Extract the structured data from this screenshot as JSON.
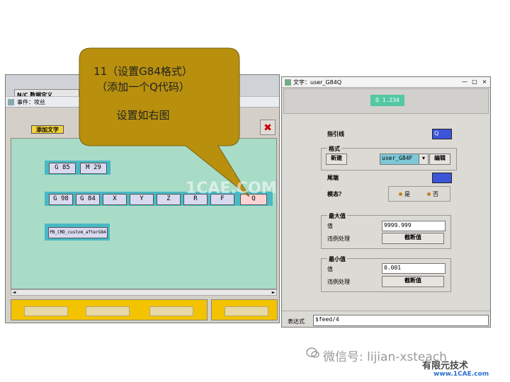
{
  "left_window": {
    "tabs": [
      "N/C 数据定义",
      ""
    ],
    "title": "事件：攻丝",
    "add_text_label": "添加文字",
    "delete_icon": "delete-icon",
    "row1": [
      "G 85",
      "M 29"
    ],
    "row2": [
      "G 98",
      "G 84",
      "X",
      "Y",
      "Z",
      "R",
      "F",
      "Q"
    ],
    "row3": [
      "PB_CMD_custom_afterG84"
    ],
    "scrollbar_arrows": [
      "◄",
      "►"
    ]
  },
  "callout": {
    "line1": "11（设置G84格式）",
    "line2": "（添加一个Q代码）",
    "line3": "设置如右图"
  },
  "dialog": {
    "title": "文字：user_G84Q",
    "window_buttons": [
      "—",
      "□",
      "×"
    ],
    "preview": "Q  1.234",
    "leader_label": "指引线",
    "leader_value": "Q",
    "format_group": "格式",
    "new_button": "新建",
    "format_value": "user_G84F",
    "edit_button": "编辑",
    "trailer_label": "尾端",
    "modal_label": "模态？",
    "yes_label": "是",
    "no_label": "否",
    "max_group": "最大值",
    "max_value_label": "值",
    "max_value": "9999.999",
    "max_violation_label": "违例处理",
    "max_violation_button": "截断值",
    "min_group": "最小值",
    "min_value_label": "值",
    "min_value": "0.001",
    "min_violation_label": "违例处理",
    "min_violation_button": "截断值",
    "expression_label": "表达式",
    "expression_value": "$feed/4"
  },
  "watermarks": {
    "center": "1CAE.COM",
    "wechat": "微信号: lijian-xsteach",
    "brand": "有限元技术",
    "site": "www.1CAE.com"
  },
  "colors": {
    "callout_fill": "#b8900e",
    "canvas": "#a9dcc7",
    "group": "#49b9c4",
    "yellow_bar": "#f4c300",
    "swatch_blue": "#3d55d8",
    "preview_green": "#54c7a3"
  }
}
